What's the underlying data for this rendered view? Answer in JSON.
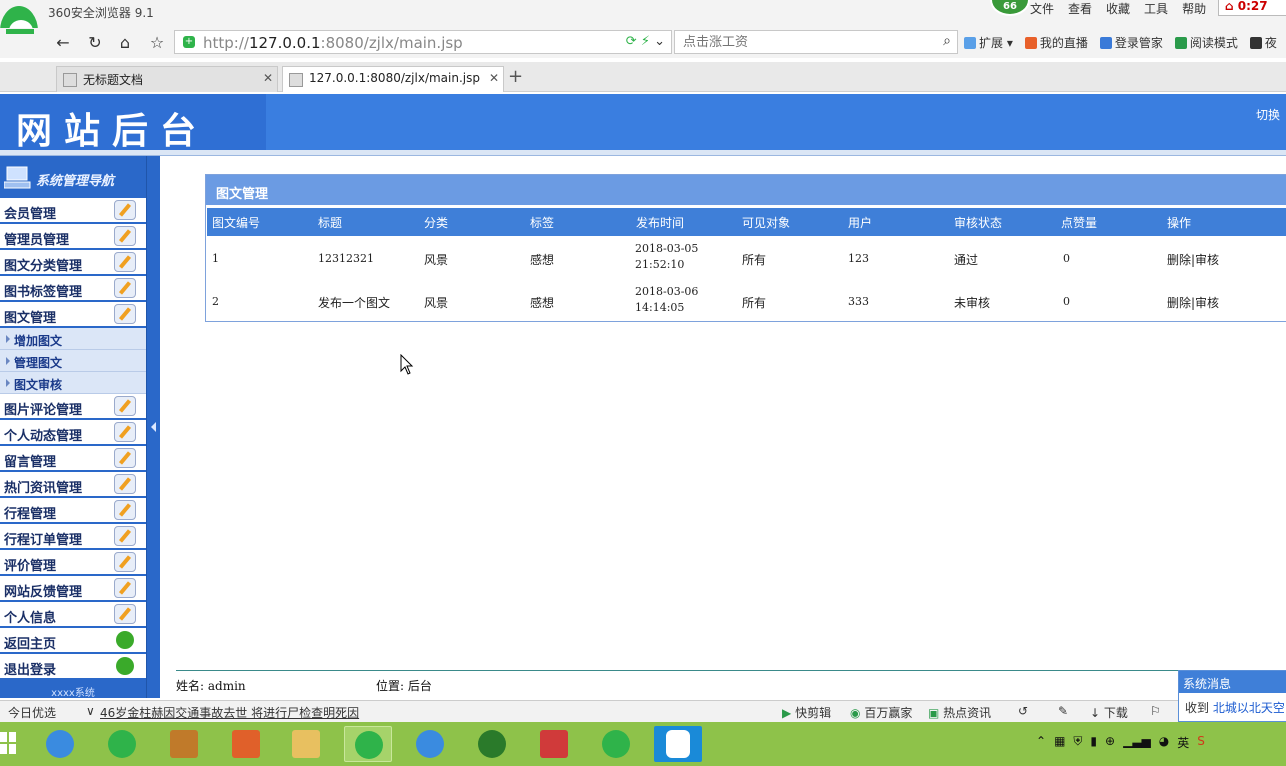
{
  "browser": {
    "app_title": "360安全浏览器 9.1",
    "badge": "66",
    "menu": [
      "文件",
      "查看",
      "收藏",
      "工具",
      "帮助"
    ],
    "clock": "0:27",
    "url_scheme": "http://",
    "url_host": "127.0.0.1",
    "url_rest": ":8080/zjlx/main.jsp",
    "search_placeholder": "点击涨工资",
    "extensions": [
      "扩展",
      "我的直播",
      "登录管家",
      "阅读模式",
      "夜"
    ],
    "tabs": [
      {
        "label": "无标题文档",
        "active": false
      },
      {
        "label": "127.0.0.1:8080/zjlx/main.jsp",
        "active": true
      }
    ]
  },
  "site": {
    "logo": "网站后台",
    "switch_label": "切换",
    "sidebar_title": "系统管理导航",
    "menu": [
      {
        "label": "会员管理",
        "icon": "edit-icon"
      },
      {
        "label": "管理员管理",
        "icon": "edit-icon"
      },
      {
        "label": "图文分类管理",
        "icon": "edit-icon"
      },
      {
        "label": "图书标签管理",
        "icon": "edit-icon"
      },
      {
        "label": "图文管理",
        "icon": "edit-icon"
      }
    ],
    "submenu": [
      "增加图文",
      "管理图文",
      "图文审核"
    ],
    "menu2": [
      {
        "label": "图片评论管理",
        "icon": "edit-icon"
      },
      {
        "label": "个人动态管理",
        "icon": "edit-icon"
      },
      {
        "label": "留言管理",
        "icon": "edit-icon"
      },
      {
        "label": "热门资讯管理",
        "icon": "edit-icon"
      },
      {
        "label": "行程管理",
        "icon": "edit-icon"
      },
      {
        "label": "行程订单管理",
        "icon": "edit-icon"
      },
      {
        "label": "评价管理",
        "icon": "edit-icon"
      },
      {
        "label": "网站反馈管理",
        "icon": "edit-icon"
      },
      {
        "label": "个人信息",
        "icon": "edit-icon"
      },
      {
        "label": "返回主页",
        "icon": "green-arrow-icon"
      },
      {
        "label": "退出登录",
        "icon": "green-play-icon"
      }
    ],
    "sidebar_footer": "xxxx系统"
  },
  "panel": {
    "title": "图文管理",
    "columns": [
      "图文编号",
      "标题",
      "分类",
      "标签",
      "发布时间",
      "可见对象",
      "用户",
      "审核状态",
      "点赞量",
      "操作"
    ],
    "rows": [
      {
        "id": "1",
        "title": "12312321",
        "category": "风景",
        "tag": "感想",
        "date": "2018-03-05",
        "time": "21:52:10",
        "visible": "所有",
        "user": "123",
        "status": "通过",
        "likes": "0",
        "actions": "删除|审核"
      },
      {
        "id": "2",
        "title": "发布一个图文",
        "category": "风景",
        "tag": "感想",
        "date": "2018-03-06",
        "time": "14:14:05",
        "visible": "所有",
        "user": "333",
        "status": "未审核",
        "likes": "0",
        "actions": "删除|审核"
      }
    ]
  },
  "footer": {
    "name_label": "姓名: admin",
    "location_label": "位置: 后台"
  },
  "statusbar": {
    "today": "今日优选",
    "news": "46岁金柱赫因交通事故去世 将进行尸检查明死因",
    "right": [
      "快剪辑",
      "百万赢家",
      "热点资讯",
      "下载"
    ]
  },
  "notification": {
    "title": "系统消息",
    "body_prefix": "收到",
    "body_link": "北城以北天空"
  },
  "tray": {
    "ime": "英"
  }
}
